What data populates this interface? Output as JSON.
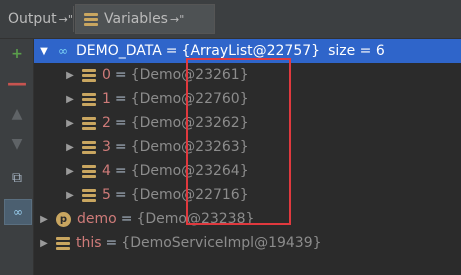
{
  "tabs": {
    "output": "Output",
    "variables": "Variables",
    "pin_glyph": "→\""
  },
  "toolbar": {
    "add_icon": "+",
    "remove_icon": "—",
    "up_icon": "▲",
    "down_icon": "▼",
    "copy_icon": "⧉",
    "watch_icon": "∞"
  },
  "tree": {
    "root": {
      "name": "DEMO_DATA",
      "value": "{ArrayList@22757}",
      "size": "size = 6"
    },
    "items": [
      {
        "name": "0",
        "value": "{Demo@23261}"
      },
      {
        "name": "1",
        "value": "{Demo@22760}"
      },
      {
        "name": "2",
        "value": "{Demo@23262}"
      },
      {
        "name": "3",
        "value": "{Demo@23263}"
      },
      {
        "name": "4",
        "value": "{Demo@23264}"
      },
      {
        "name": "5",
        "value": "{Demo@22716}"
      }
    ],
    "demo": {
      "badge": "p",
      "name": "demo",
      "value": "{Demo@23238}"
    },
    "this": {
      "name": "this",
      "value": "{DemoServiceImpl@19439}"
    }
  },
  "colors": {
    "selection": "#2f65ca",
    "highlight_box": "#e0393e",
    "field_name": "#cf7b79"
  }
}
